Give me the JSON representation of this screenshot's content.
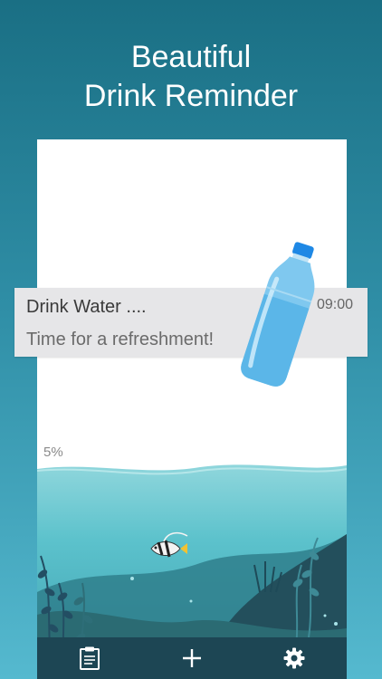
{
  "promo": {
    "headline_line1": "Beautiful",
    "headline_line2": "Drink Reminder"
  },
  "notification": {
    "title": "Drink Water ....",
    "time": "09:00",
    "message": "Time for a refreshment!"
  },
  "progress": {
    "label": "5%",
    "value": 0.05
  },
  "bottom_nav": [
    {
      "icon": "clipboard-icon"
    },
    {
      "icon": "plus-icon"
    },
    {
      "icon": "gear-icon"
    }
  ],
  "colors": {
    "background_top": "#1a6f84",
    "background_bottom": "#55b9cf",
    "water": "#5cc2cc",
    "nav_bar": "#1d4654",
    "notification_bg": "#e6e6e8"
  }
}
